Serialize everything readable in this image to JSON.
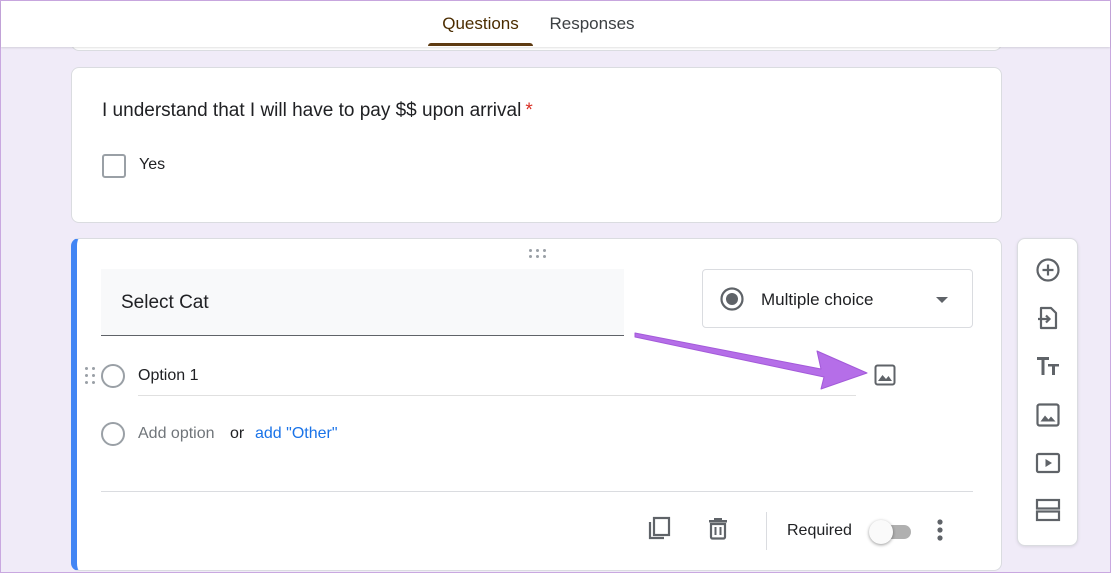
{
  "tabs": [
    {
      "label": "Questions",
      "active": true
    },
    {
      "label": "Responses",
      "active": false
    }
  ],
  "question1": {
    "title": "I understand that I will have to pay $$ upon arrival",
    "required_mark": "*",
    "options": [
      "Yes"
    ]
  },
  "question2": {
    "title": "Select Cat",
    "type": "Multiple choice",
    "options": [
      "Option 1"
    ],
    "add_option": "Add option",
    "or": "or",
    "add_other": "add \"Other\"",
    "required_label": "Required",
    "required_on": false
  },
  "icons": {
    "type_icon": "radio-button-icon",
    "dropdown": "chevron-down-icon",
    "option_image": "image-icon",
    "copy": "copy-icon",
    "delete": "trash-icon",
    "more": "more-vert-icon",
    "toolbar": [
      "add-question-icon",
      "import-questions-icon",
      "add-title-icon",
      "add-image-icon",
      "add-video-icon",
      "add-section-icon"
    ]
  },
  "colors": {
    "accent_blue": "#4285f4",
    "link_blue": "#1a73e8",
    "required_red": "#d93025",
    "annotation_arrow": "#b56ee8",
    "page_bg": "#f0ebf8"
  }
}
